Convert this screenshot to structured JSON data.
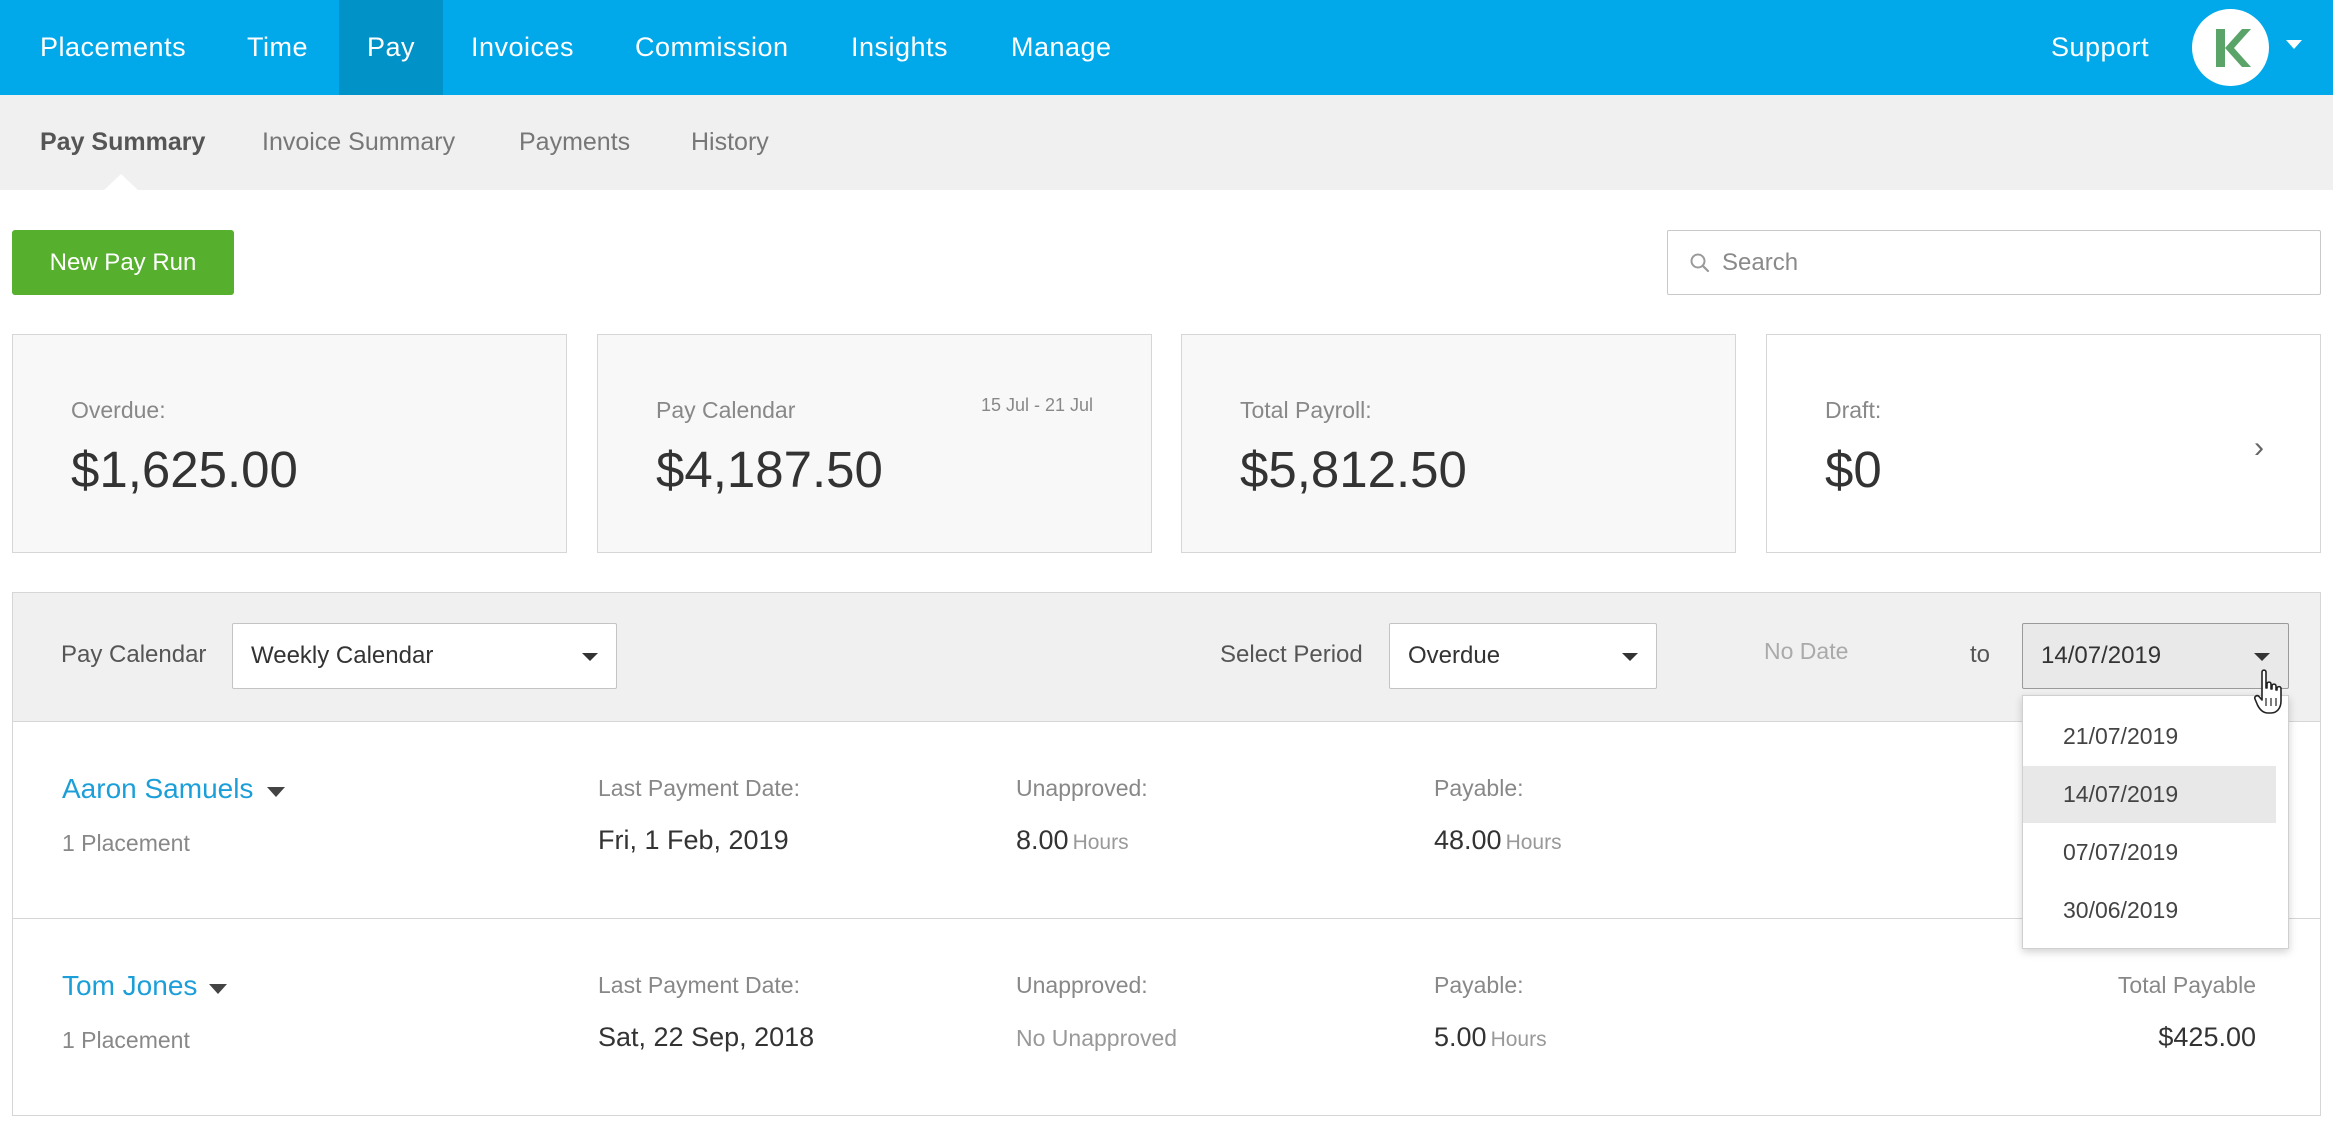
{
  "nav": {
    "items": [
      {
        "label": "Placements"
      },
      {
        "label": "Time"
      },
      {
        "label": "Pay"
      },
      {
        "label": "Invoices"
      },
      {
        "label": "Commission"
      },
      {
        "label": "Insights"
      },
      {
        "label": "Manage"
      }
    ],
    "active": "Pay",
    "support_label": "Support",
    "avatar_icon": "k-logo-icon",
    "brand_color": "#02a9ea",
    "logo_color": "#5aa469"
  },
  "subnav": {
    "items": [
      {
        "label": "Pay Summary"
      },
      {
        "label": "Invoice Summary"
      },
      {
        "label": "Payments"
      },
      {
        "label": "History"
      }
    ],
    "active": "Pay Summary"
  },
  "actions": {
    "new_pay_run_label": "New Pay Run",
    "new_pay_run_color": "#56b02d",
    "search_placeholder": "Search",
    "search_value": ""
  },
  "cards": [
    {
      "label": "Overdue:",
      "value": "$1,625.00"
    },
    {
      "label": "Pay Calendar",
      "range": "15 Jul - 21 Jul",
      "value": "$4,187.50"
    },
    {
      "label": "Total Payroll:",
      "value": "$5,812.50"
    },
    {
      "label": "Draft:",
      "value": "$0",
      "arrow": "›"
    }
  ],
  "filters": {
    "pay_calendar_label": "Pay Calendar",
    "pay_calendar_value": "Weekly Calendar",
    "select_period_label": "Select Period",
    "select_period_value": "Overdue",
    "from_date": "No Date",
    "to_label": "to",
    "to_date_value": "14/07/2019",
    "to_date_options": [
      "21/07/2019",
      "14/07/2019",
      "07/07/2019",
      "30/06/2019"
    ],
    "to_date_highlighted": "14/07/2019"
  },
  "employees": [
    {
      "name": "Aaron Samuels",
      "placements": "1 Placement",
      "last_payment_label": "Last Payment Date:",
      "last_payment": "Fri, 1 Feb, 2019",
      "unapproved_label": "Unapproved:",
      "unapproved": "8.00",
      "unapproved_unit": "Hours",
      "payable_label": "Payable:",
      "payable": "48.00",
      "payable_unit": "Hours"
    },
    {
      "name": "Tom Jones",
      "placements": "1 Placement",
      "last_payment_label": "Last Payment Date:",
      "last_payment": "Sat, 22 Sep, 2018",
      "unapproved_label": "Unapproved:",
      "unapproved_text": "No Unapproved",
      "payable_label": "Payable:",
      "payable": "5.00",
      "payable_unit": "Hours",
      "total_payable_label": "Total Payable",
      "total_payable": "$425.00"
    }
  ]
}
